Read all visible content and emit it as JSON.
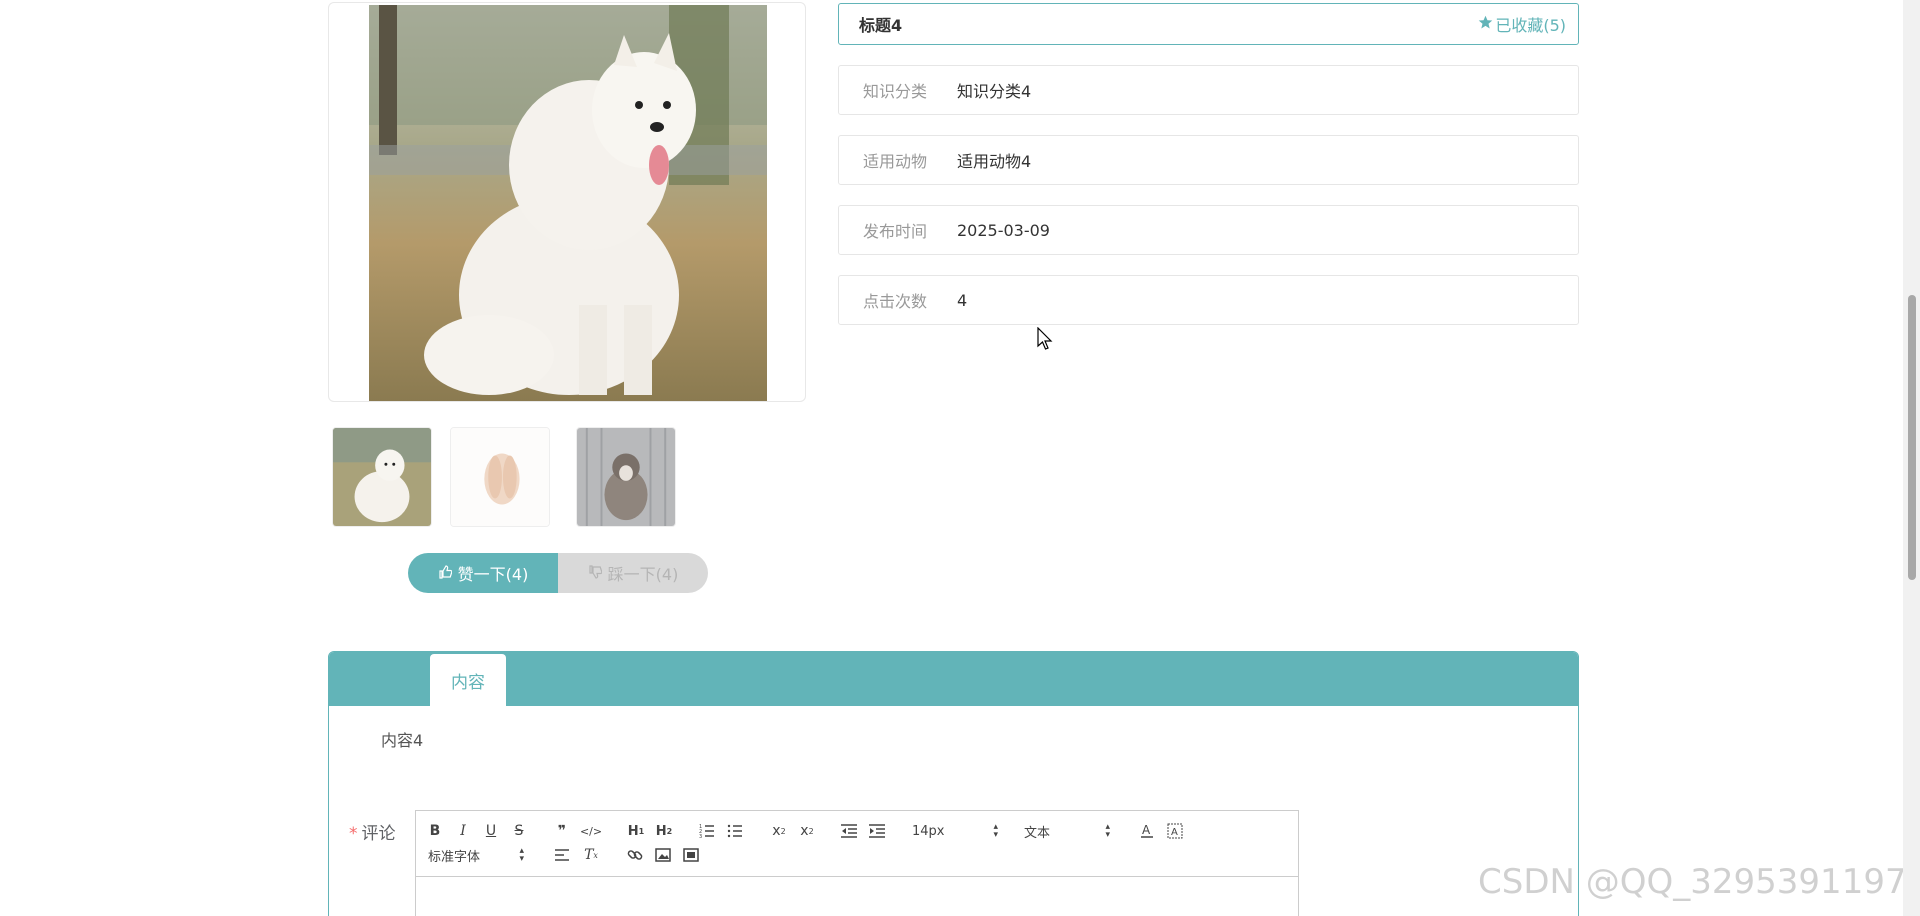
{
  "product": {
    "title": "标题4",
    "favorite_label": "已收藏(5)",
    "fields": [
      {
        "label": "知识分类",
        "value": "知识分类4"
      },
      {
        "label": "适用动物",
        "value": "适用动物4"
      },
      {
        "label": "发布时间",
        "value": "2025-03-09"
      },
      {
        "label": "点击次数",
        "value": "4"
      }
    ],
    "like_label": "赞一下(4)",
    "dislike_label": "踩一下(4)"
  },
  "tabs": [
    {
      "label": "内容"
    }
  ],
  "content": {
    "text": "内容4"
  },
  "comment": {
    "label": "评论",
    "required_mark": "*",
    "toolbar": {
      "font_size": "14px",
      "header_type": "文本",
      "font_family": "标准字体"
    }
  },
  "watermark": "CSDN @QQ_3295391197",
  "colors": {
    "accent": "#62b4b8",
    "muted": "#d9d9d9"
  }
}
